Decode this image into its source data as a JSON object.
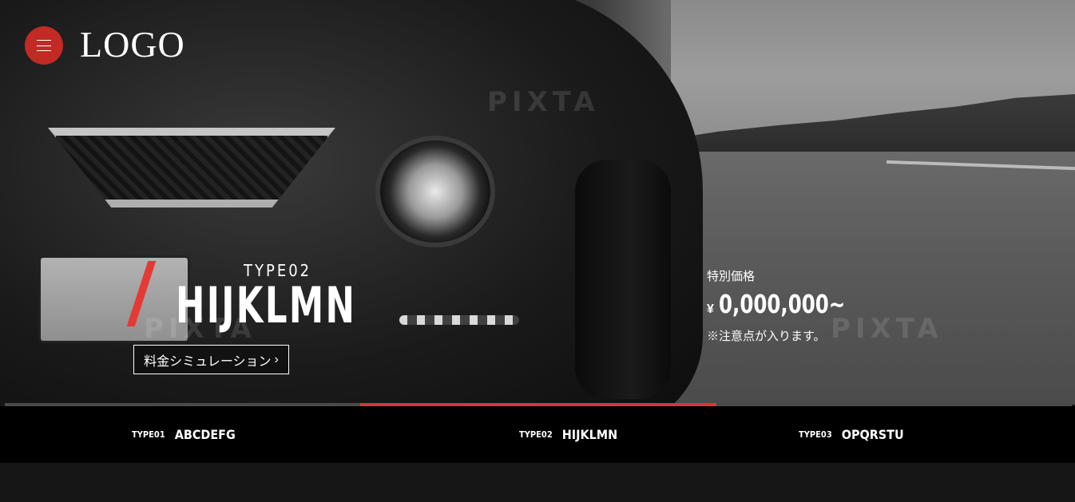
{
  "header": {
    "logo_text": "LOGO",
    "menu_icon": "hamburger-menu-icon"
  },
  "hero": {
    "watermark_text": "PIXTA",
    "model_type": "TYPE02",
    "model_name": "HIJKLMN",
    "simulation_button_label": "料金シミュレーション",
    "simulation_button_arrow": "›",
    "price_label": "特別価格",
    "price_currency": "¥",
    "price_amount": "0,000,000~",
    "price_note": "※注意点が入ります。"
  },
  "carousel": {
    "active_index": 1,
    "tabs": [
      {
        "type": "TYPE01",
        "name": "ABCDEFG"
      },
      {
        "type": "TYPE02",
        "name": "HIJKLMN"
      },
      {
        "type": "TYPE03",
        "name": "OPQRSTU"
      }
    ]
  },
  "colors": {
    "accent": "#d93636",
    "menu_button": "#c22a25",
    "tab_bar": "#000000",
    "page_bg": "#161616"
  }
}
